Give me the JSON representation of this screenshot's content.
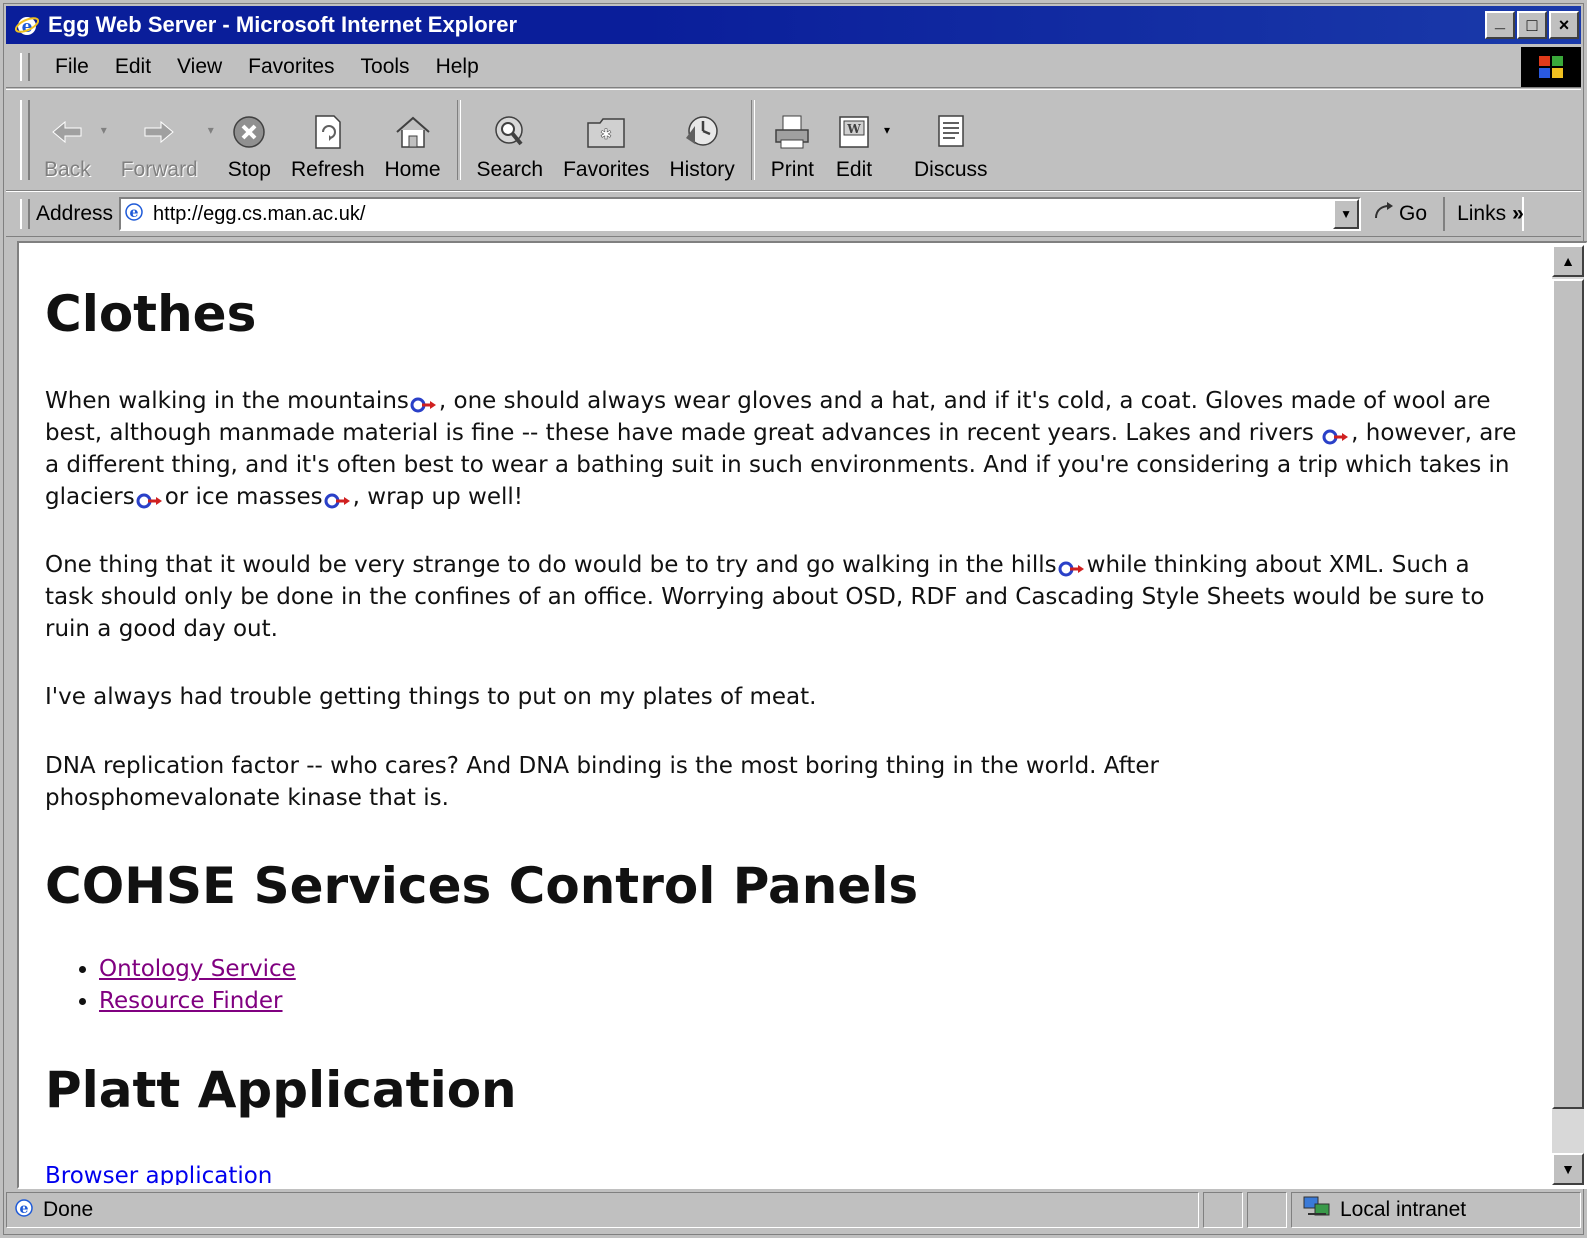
{
  "window": {
    "title": "Egg Web Server - Microsoft Internet Explorer",
    "controls": [
      "_",
      "□",
      "×"
    ]
  },
  "menu": {
    "items": [
      "File",
      "Edit",
      "View",
      "Favorites",
      "Tools",
      "Help"
    ]
  },
  "toolbar": {
    "back": "Back",
    "forward": "Forward",
    "stop": "Stop",
    "refresh": "Refresh",
    "home": "Home",
    "search": "Search",
    "favorites": "Favorites",
    "history": "History",
    "print": "Print",
    "edit": "Edit",
    "discuss": "Discuss"
  },
  "address": {
    "label": "Address",
    "url": "http://egg.cs.man.ac.uk/",
    "go": "Go",
    "links": "Links"
  },
  "page": {
    "h_clothes": "Clothes",
    "p1": [
      "When walking in the mountains",
      ", one should always wear gloves and a hat, and if it's cold, a coat. Gloves made of wool are best, although manmade material is fine -- these have made great advances in recent years. Lakes and rivers ",
      ", however, are a different thing, and it's often best to wear a bathing suit in such environments. And if you're considering a trip which takes in glaciers",
      "or ice masses",
      ", wrap up well!"
    ],
    "p2": [
      "One thing that it would be very strange to do would be to try and go walking in the hills",
      "while thinking about XML. Such a task should only be done in the confines of an office. Worrying about OSD, RDF and Cascading Style Sheets would be sure to ruin a good day out."
    ],
    "p3": "I've always had trouble getting things to put on my plates of meat.",
    "p4": "DNA replication factor -- who cares? And DNA binding is the most boring thing in the world. After phosphomevalonate kinase that is.",
    "h_cohse": "COHSE Services Control Panels",
    "cohse_links": [
      "Ontology Service",
      "Resource Finder"
    ],
    "h_platt": "Platt Application",
    "platt_link": "Browser application"
  },
  "status": {
    "text": "Done",
    "zone": "Local intranet"
  },
  "colors": {
    "titlebar": "#0a1e9a",
    "chrome": "#c0c0c0",
    "visited_link": "#800080",
    "link": "#0000ee"
  }
}
